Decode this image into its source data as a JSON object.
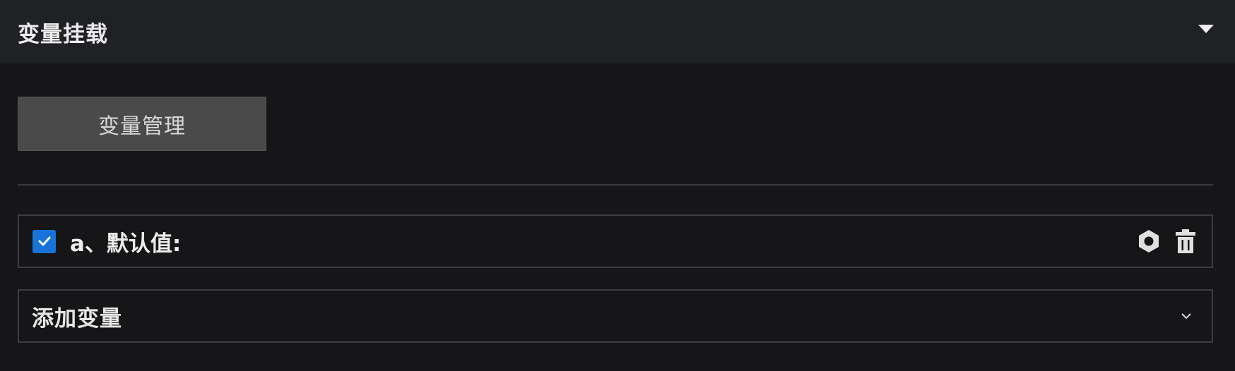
{
  "panel": {
    "title": "变量挂载",
    "collapse_icon": "caret-down-icon"
  },
  "manage_button": {
    "label": "变量管理"
  },
  "variables": [
    {
      "checked": true,
      "label": "a、默认值:",
      "actions": [
        "settings-hexagon-icon",
        "trash-icon"
      ]
    }
  ],
  "add_variable": {
    "label": "添加变量",
    "icon": "chevron-down-icon"
  },
  "colors": {
    "background": "#161618",
    "header": "#202125",
    "button": "#4a4a4a",
    "checkbox_accent": "#1a73d9",
    "border": "#3d3d40"
  }
}
